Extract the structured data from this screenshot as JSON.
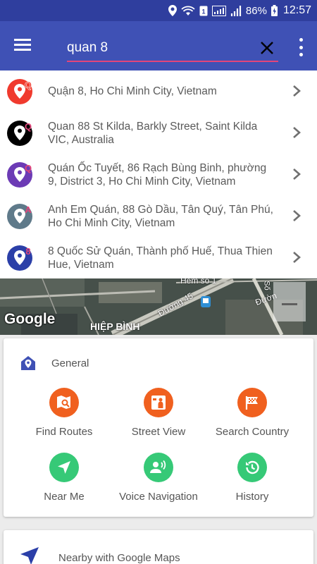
{
  "status_bar": {
    "battery": "86%",
    "time": "12:57"
  },
  "search": {
    "value": "quan 8"
  },
  "suggestions": [
    {
      "badge": "Q",
      "color": "#f03a2e",
      "text": "Quận 8, Ho Chi Minh City, Vietnam"
    },
    {
      "badge": "Q",
      "color": "#000000",
      "text": "Quan 88 St Kilda, Barkly Street, Saint Kilda VIC, Australia"
    },
    {
      "badge": "Q",
      "color": "#6c3bb5",
      "text": "Quán Ốc Tuyết, 86 Rạch Bùng Binh, phường 9, District 3, Ho Chi Minh City, Vietnam"
    },
    {
      "badge": "A",
      "color": "#5f7a8a",
      "text": "Anh Em Quán, 88 Gò Dầu, Tân Quý, Tân Phú, Ho Chi Minh City, Vietnam"
    },
    {
      "badge": "8",
      "color": "#2b3fa8",
      "text": "8 Quốc Sử Quán, Thành phố Huế, Thua Thien Hue, Vietnam"
    }
  ],
  "map": {
    "logo": "Google",
    "labels": {
      "district": "HIỆP BÌNH",
      "road": "Đường 45",
      "alley": "Hẻm số 1",
      "road_right": "Đườn",
      "road_edge": "Số"
    }
  },
  "general_card": {
    "title": "General",
    "items": [
      {
        "label": "Find Routes",
        "icon": "map-search-icon",
        "color": "#f0601f"
      },
      {
        "label": "Street View",
        "icon": "street-view-icon",
        "color": "#f0601f"
      },
      {
        "label": "Search Country",
        "icon": "flag-icon",
        "color": "#f0601f"
      },
      {
        "label": "Near Me",
        "icon": "navigation-arrow-icon",
        "color": "#36c977"
      },
      {
        "label": "Voice Navigation",
        "icon": "voice-icon",
        "color": "#36c977"
      },
      {
        "label": "History",
        "icon": "history-icon",
        "color": "#36c977"
      }
    ]
  },
  "nearby_card": {
    "title": "Nearby with Google Maps"
  },
  "colors": {
    "app_bar": "#3f51b5",
    "status_bar": "#2f3e9e",
    "accent": "#e2457a",
    "orange": "#f0601f",
    "green": "#36c977"
  }
}
